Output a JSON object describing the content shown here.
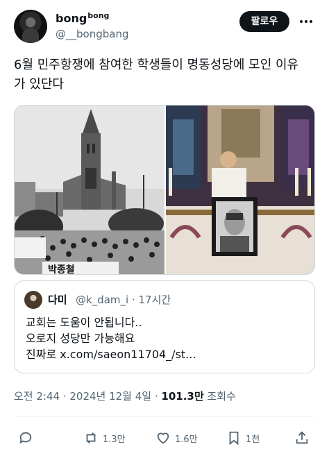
{
  "header": {
    "display_name": "bong",
    "display_name_sup": "bong",
    "handle": "@__bongbang",
    "follow_label": "팔로우",
    "more_icon": "more-icon"
  },
  "tweet": {
    "lines": [
      "6월 민주항쟁에 참여한 학생들이 명동성당에 모인 이유",
      "가 있단다"
    ]
  },
  "media": {
    "left_photo_sign": "박종철",
    "right_photo": "portrait at altar"
  },
  "quote": {
    "name": "다미",
    "meta": "@k_dam_i · 17시간",
    "lines": [
      "교회는 도움이 안됩니다..",
      "오로지 성당만 가능해요",
      "진짜로 x.com/saeon11704_/st..."
    ]
  },
  "meta": {
    "time_date": "오전 2:44 · 2024년 12월 4일 · ",
    "views": "101.3만",
    "views_label": " 조회수"
  },
  "actions": {
    "reply_count": "",
    "retweet_count": "1.3만",
    "like_count": "1.6만",
    "bookmark_count": "1천"
  }
}
